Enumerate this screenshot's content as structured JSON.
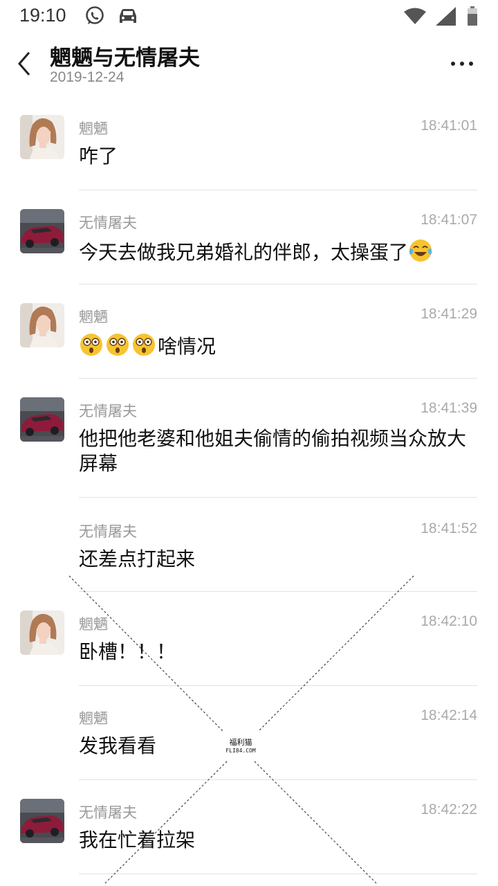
{
  "status_bar": {
    "time": "19:10",
    "icons": [
      "whatsapp-icon",
      "car-icon",
      "wifi-icon",
      "signal-icon",
      "battery-icon"
    ]
  },
  "header": {
    "title": "魍魉与无情屠夫",
    "date": "2019-12-24",
    "back_icon": "chevron-left-icon",
    "more_icon": "more-icon"
  },
  "messages": [
    {
      "sender": "魍魉",
      "time": "18:41:01",
      "text": "咋了",
      "avatar": "girl"
    },
    {
      "sender": "无情屠夫",
      "time": "18:41:07",
      "text": "今天去做我兄弟婚礼的伴郎，太操蛋了",
      "avatar": "car",
      "emoji": "tears-of-joy-emoji"
    },
    {
      "sender": "魍魉",
      "time": "18:41:29",
      "text": "啥情况",
      "avatar": "girl",
      "emoji": "astonished-emoji"
    },
    {
      "sender": "无情屠夫",
      "time": "18:41:39",
      "text": "他把他老婆和他姐夫偷情的偷拍视频当众放大屏幕",
      "avatar": "car"
    },
    {
      "sender": "无情屠夫",
      "time": "18:41:52",
      "text": "还差点打起来",
      "avatar": null
    },
    {
      "sender": "魍魉",
      "time": "18:42:10",
      "text": "卧槽！！！",
      "avatar": "girl"
    },
    {
      "sender": "魍魉",
      "time": "18:42:14",
      "text": "发我看看",
      "avatar": null
    },
    {
      "sender": "无情屠夫",
      "time": "18:42:22",
      "text": "我在忙着拉架",
      "avatar": "car"
    }
  ],
  "watermark": {
    "title": "福利猫",
    "url": "FLI84.COM"
  }
}
